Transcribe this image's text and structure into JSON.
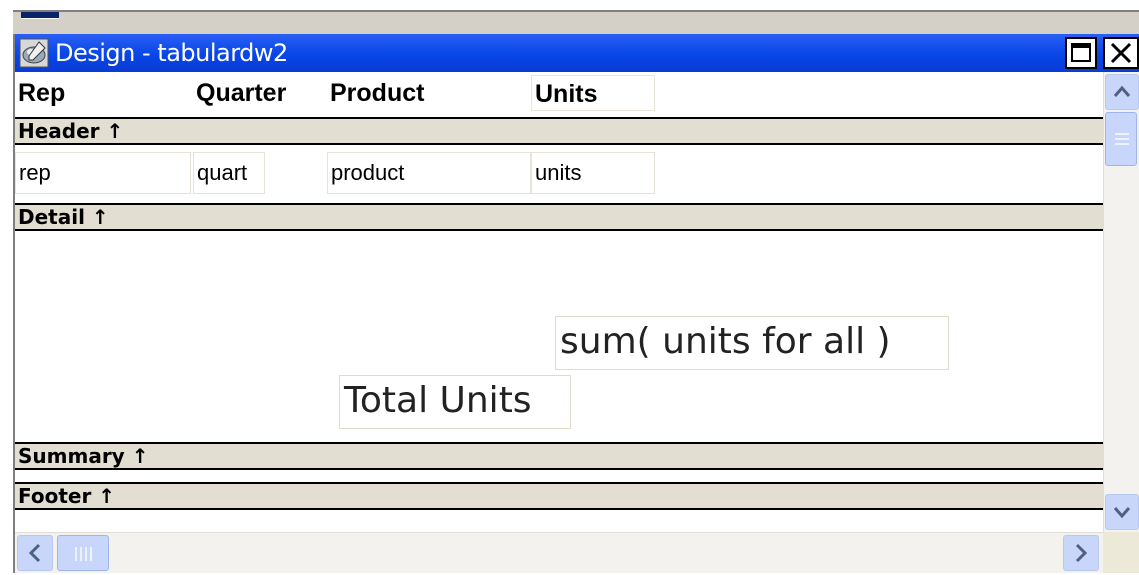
{
  "window": {
    "title": "Design - tabulardw2",
    "maximize_icon": "maximize-icon",
    "close_icon": "close-icon",
    "app_icon": "datawindow-painter-icon",
    "titlebar_color": "#0846e6"
  },
  "header_columns": [
    "Rep",
    "Quarter",
    "Product",
    "Units"
  ],
  "bands": {
    "header": "Header",
    "detail": "Detail",
    "summary": "Summary",
    "footer": "Footer",
    "band_arrow": "↑"
  },
  "detail_fields": [
    "rep",
    "quart",
    "product",
    "units"
  ],
  "summary": {
    "computed_field": "sum(  units  for all )",
    "label": "Total Units"
  },
  "scrollbars": {
    "up_icon": "chevron-up-icon",
    "down_icon": "chevron-down-icon",
    "left_icon": "chevron-left-icon",
    "right_icon": "chevron-right-icon"
  }
}
